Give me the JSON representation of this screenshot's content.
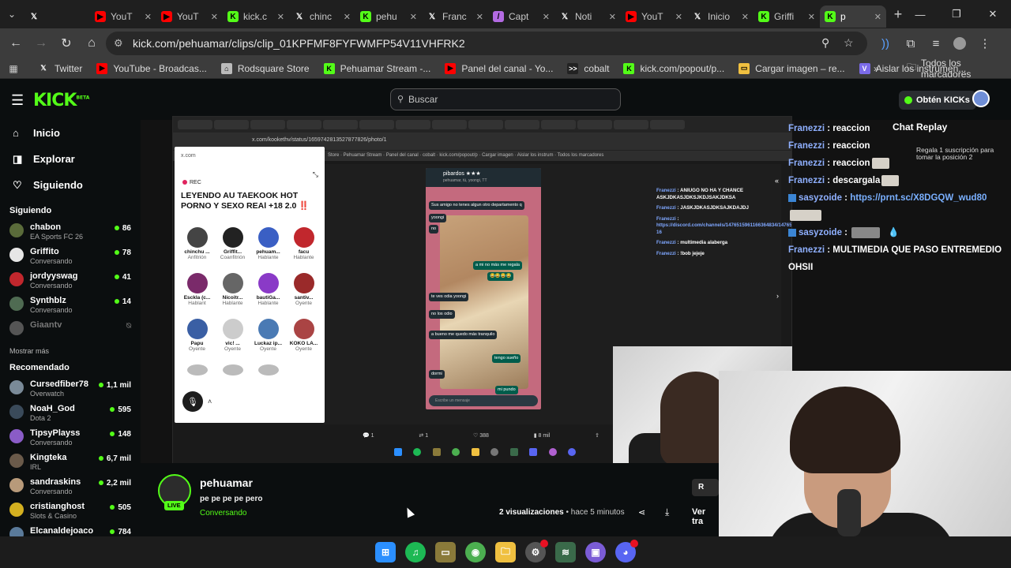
{
  "browser": {
    "tabs": [
      {
        "label": "YouT",
        "fav": "yt"
      },
      {
        "label": "YouT",
        "fav": "yt"
      },
      {
        "label": "kick.c",
        "fav": "kick"
      },
      {
        "label": "chinc",
        "fav": "x"
      },
      {
        "label": "pehu",
        "fav": "kick"
      },
      {
        "label": "Franc",
        "fav": "x"
      },
      {
        "label": "Capt",
        "fav": "capt"
      },
      {
        "label": "Noti",
        "fav": "x"
      },
      {
        "label": "YouT",
        "fav": "yt"
      },
      {
        "label": "Inicio",
        "fav": "x"
      },
      {
        "label": "Griffi",
        "fav": "kick"
      },
      {
        "label": "p",
        "fav": "kick"
      }
    ],
    "url": "kick.com/pehuamar/clips/clip_01KPFMF8FYFWMFP54V11VHFRK2",
    "bookmarks": [
      {
        "label": "Twitter",
        "icon": "x"
      },
      {
        "label": "YouTube - Broadcas...",
        "icon": "yt"
      },
      {
        "label": "Rodsquare Store",
        "icon": "store"
      },
      {
        "label": "Pehuamar Stream -...",
        "icon": "kick"
      },
      {
        "label": "Panel del canal - Yo...",
        "icon": "yt"
      },
      {
        "label": "cobalt",
        "icon": "cobalt"
      },
      {
        "label": "kick.com/popout/p...",
        "icon": "kick"
      },
      {
        "label": "Cargar imagen – re...",
        "icon": "img"
      },
      {
        "label": "Aislar los instrumen...",
        "icon": "v"
      }
    ],
    "all_bookmarks": "Todos los marcadores"
  },
  "kick": {
    "logo": "KICK",
    "logo_beta": "BETA",
    "search_placeholder": "Buscar",
    "get_kicks": "Obtén KICKs",
    "nav": [
      {
        "label": "Inicio",
        "icon": "home-icon"
      },
      {
        "label": "Explorar",
        "icon": "explore-icon"
      },
      {
        "label": "Siguiendo",
        "icon": "heart-icon"
      }
    ],
    "following_title": "Siguiendo",
    "following": [
      {
        "name": "chabon",
        "sub": "EA Sports FC 26",
        "viewers": "86",
        "color": "#5a6b3a"
      },
      {
        "name": "Griffito",
        "sub": "Conversando",
        "viewers": "78",
        "color": "#e6e6e6"
      },
      {
        "name": "jordyyswag",
        "sub": "Conversando",
        "viewers": "41",
        "color": "#c1272d"
      },
      {
        "name": "Synthblz",
        "sub": "Conversando",
        "viewers": "14",
        "color": "#4f6b52"
      },
      {
        "name": "Giaantv",
        "sub": "",
        "viewers": "",
        "color": "#555555"
      }
    ],
    "show_more": "Mostrar más",
    "recommended_title": "Recomendado",
    "recommended": [
      {
        "name": "Cursedfiber78",
        "sub": "Overwatch",
        "viewers": "1,1 mil",
        "color": "#7a8a98"
      },
      {
        "name": "NoaH_God",
        "sub": "Dota 2",
        "viewers": "595",
        "color": "#3a4a5a"
      },
      {
        "name": "TipsyPlayss",
        "sub": "Conversando",
        "viewers": "148",
        "color": "#8a5cc7"
      },
      {
        "name": "Kingteka",
        "sub": "IRL",
        "viewers": "6,7 mil",
        "color": "#6a5a4a"
      },
      {
        "name": "sandraskins",
        "sub": "Conversando",
        "viewers": "2,2 mil",
        "color": "#b89a7a"
      },
      {
        "name": "cristianghost",
        "sub": "Slots & Casino",
        "viewers": "505",
        "color": "#d4b020"
      },
      {
        "name": "Elcanaldejoaco",
        "sub": "",
        "viewers": "784",
        "color": "#5a7a9a"
      }
    ]
  },
  "recording": {
    "x_url": "x.com/kookethv/status/1659742813527877826/photo/1",
    "space": {
      "rec_label": "REC",
      "title": "LEYENDO AU TAEKOOK HOT PORNO Y SEXO REAl +18 2.0 ‼️",
      "speakers": [
        {
          "name": "chinchu ...",
          "role": "Anfitrión",
          "color": "#444"
        },
        {
          "name": "Griffit...",
          "role": "Coanfitrión",
          "color": "#222"
        },
        {
          "name": "pehuam...",
          "role": "Hablante",
          "color": "#3a5fc4"
        },
        {
          "name": "facu",
          "role": "Hablante",
          "color": "#c1272d"
        },
        {
          "name": "Esckla (c...",
          "role": "Hablant",
          "color": "#7a2a6a"
        },
        {
          "name": "Nicoitr...",
          "role": "Hablante",
          "color": "#666"
        },
        {
          "name": "bautiGa...",
          "role": "Hablante",
          "color": "#8a3ac7"
        },
        {
          "name": "santiv...",
          "role": "Oyente",
          "color": "#9a2a2a"
        },
        {
          "name": "Papu",
          "role": "Oyente",
          "color": "#3a5fa4"
        },
        {
          "name": "vic! ...",
          "role": "Oyente",
          "color": "#ccc"
        },
        {
          "name": "Luckaz ip...",
          "role": "Oyente",
          "color": "#4a7ab4"
        },
        {
          "name": "KOKO LA...",
          "role": "Oyente",
          "color": "#a44"
        }
      ]
    },
    "phone": {
      "contact": "pibardos ★★★",
      "contact_sub": "pehuamar, tú, yoongi, TT",
      "messages": [
        {
          "text": "Sus amigo no tenes algun otro departamento q",
          "dir": "in"
        },
        {
          "text": "yoongi",
          "dir": "in"
        },
        {
          "text": "no",
          "dir": "in"
        },
        {
          "text": "a mi no más me regala",
          "dir": "out"
        },
        {
          "text": "😂😂😂😂",
          "dir": "out"
        },
        {
          "text": "te ves odia yoongi",
          "dir": "in"
        },
        {
          "text": "no los odio",
          "dir": "in"
        },
        {
          "text": "a bueno me quedo más tranquilo",
          "dir": "in"
        },
        {
          "text": "tengo sueño",
          "dir": "out"
        },
        {
          "text": "dormi",
          "dir": "in"
        },
        {
          "text": "mi pundo",
          "dir": "out"
        }
      ],
      "input_placeholder": "Escribe un mensaje"
    },
    "x_chat": [
      {
        "user": "Franezzi",
        "text": "ANIUGO NO HA Y CHANCE ASKJDKASJDKSJKDJSAKJDKSA"
      },
      {
        "user": "Franezzi",
        "text": "JASKJDKASJDKSAJKDAJDJ"
      },
      {
        "user": "Franezzi",
        "text": "https://discord.com/channels/1476515961166364834/1476517972615888926/1494946157170917 16"
      },
      {
        "user": "Franezzi",
        "text": "multimedia alaberga"
      },
      {
        "user": "Franezzi",
        "text": "!bob jejeje"
      }
    ],
    "x_stats": {
      "replies": "1",
      "reposts": "1",
      "likes": "388",
      "views": "8 mil"
    }
  },
  "chat": {
    "replay_title": "Chat Replay",
    "subgift": "Regala 1 suscripción para tomar la posición 2",
    "messages": [
      {
        "user": "Franezzi",
        "text": "reaccion",
        "badge": false,
        "link": false
      },
      {
        "user": "Franezzi",
        "text": "reaccion",
        "badge": false,
        "link": false
      },
      {
        "user": "Franezzi",
        "text": "reaccion",
        "badge": false,
        "link": false
      },
      {
        "user": "Franezzi",
        "text": "descargala",
        "badge": false,
        "link": false
      },
      {
        "user": "sasyzoide",
        "text": "https://prnt.sc/X8DGQW_wud80",
        "badge": true,
        "link": true
      },
      {
        "user": "sasyzoide",
        "text": "",
        "badge": true,
        "link": false
      },
      {
        "user": "Franezzi",
        "text": "MULTIMEDIA QUE PASO ENTREMEDIO OHSII",
        "badge": false,
        "link": false
      }
    ]
  },
  "clip": {
    "channel": "pehuamar",
    "live_badge": "LIVE",
    "title": "pe pe pe pe pero",
    "category": "Conversando",
    "views_count": "2",
    "views_label": "visualizaciones",
    "time_ago": "hace 5 minutos",
    "watch_label": "Ver tra",
    "clip_label": "R"
  },
  "colors": {
    "kick_green": "#53fc18",
    "chat_username": "#8fb0ff",
    "bg": "#0b0e0f"
  }
}
